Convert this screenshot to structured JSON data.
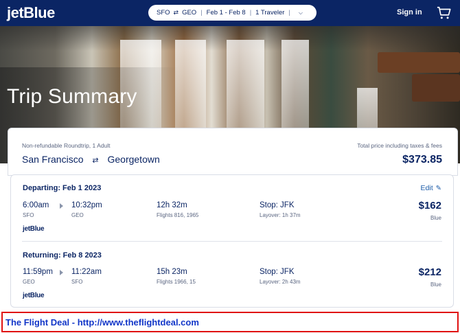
{
  "header": {
    "logo": "jetBlue",
    "search": {
      "origin": "SFO",
      "destination": "GEO",
      "dates": "Feb 1 - Feb 8",
      "travelers": "1 Traveler"
    },
    "signin_label": "Sign in",
    "icons": {
      "swap": "swap-arrows-icon",
      "dropdown": "chevron-down-icon",
      "cart": "shopping-cart-icon"
    }
  },
  "hero": {
    "title": "Trip Summary"
  },
  "summary": {
    "fare_type": "Non-refundable Roundtrip, 1 Adult",
    "origin_city": "San Francisco",
    "destination_city": "Georgetown",
    "price_caption": "Total price including taxes & fees",
    "total_price": "$373.85"
  },
  "segments": [
    {
      "title": "Departing: Feb 1 2023",
      "edit_label": "Edit",
      "depart_time": "6:00am",
      "depart_airport": "SFO",
      "arrive_time": "10:32pm",
      "arrive_airport": "GEO",
      "duration": "12h 32m",
      "flights": "Flights 816, 1965",
      "stop": "Stop: JFK",
      "layover": "Layover: 1h 37m",
      "price": "$162",
      "fare": "Blue",
      "carrier": "jetBlue"
    },
    {
      "title": "Returning: Feb 8 2023",
      "depart_time": "11:59pm",
      "depart_airport": "GEO",
      "arrive_time": "11:22am",
      "arrive_airport": "SFO",
      "duration": "15h 23m",
      "flights": "Flights 1966, 15",
      "stop": "Stop: JFK",
      "layover": "Layover: 2h 43m",
      "price": "$212",
      "fare": "Blue",
      "carrier": "jetBlue"
    }
  ],
  "banner": {
    "text": "The Flight Deal - http://www.theflightdeal.com"
  },
  "colors": {
    "nav_bg": "#0b2564",
    "text_primary": "#0b2564",
    "link": "#1a5aa8",
    "banner_border": "#e01010",
    "banner_text": "#1236c8"
  }
}
